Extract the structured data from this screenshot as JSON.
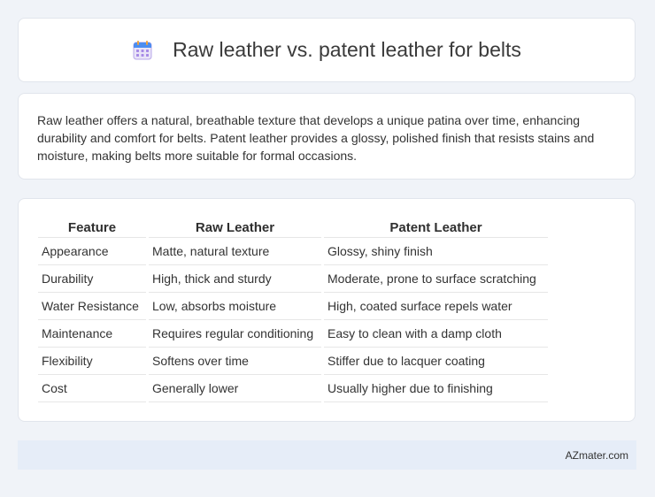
{
  "header": {
    "title": "Raw leather vs. patent leather for belts",
    "icon": "calendar-icon"
  },
  "description": "Raw leather offers a natural, breathable texture that develops a unique patina over time, enhancing durability and comfort for belts. Patent leather provides a glossy, polished finish that resists stains and moisture, making belts more suitable for formal occasions.",
  "table": {
    "headers": [
      "Feature",
      "Raw Leather",
      "Patent Leather"
    ],
    "rows": [
      [
        "Appearance",
        "Matte, natural texture",
        "Glossy, shiny finish"
      ],
      [
        "Durability",
        "High, thick and sturdy",
        "Moderate, prone to surface scratching"
      ],
      [
        "Water Resistance",
        "Low, absorbs moisture",
        "High, coated surface repels water"
      ],
      [
        "Maintenance",
        "Requires regular conditioning",
        "Easy to clean with a damp cloth"
      ],
      [
        "Flexibility",
        "Softens over time",
        "Stiffer due to lacquer coating"
      ],
      [
        "Cost",
        "Generally lower",
        "Usually higher due to finishing"
      ]
    ]
  },
  "footer": {
    "brand": "AZmater.com"
  }
}
